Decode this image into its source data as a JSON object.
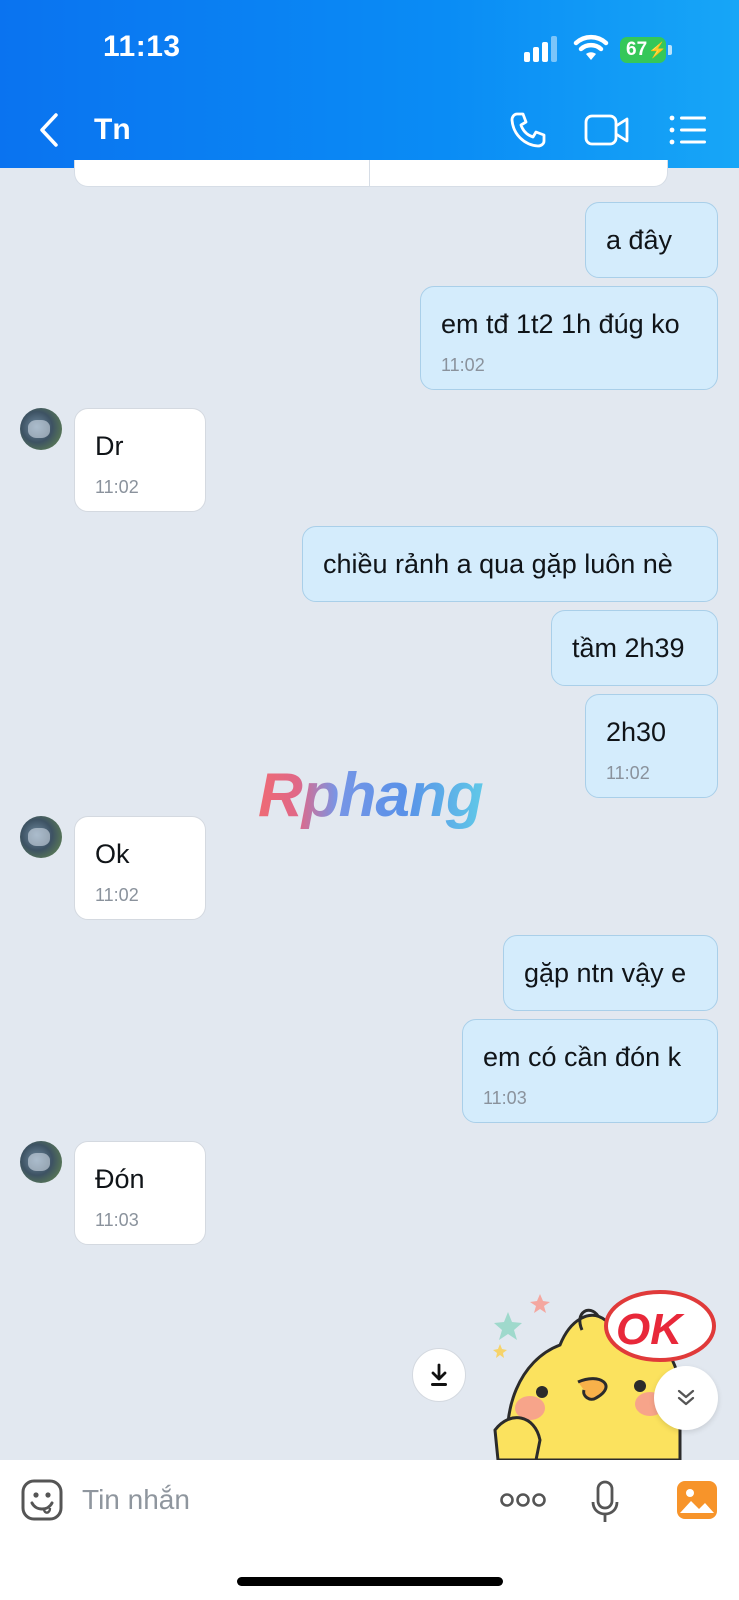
{
  "status_bar": {
    "time": "11:13",
    "battery": "67"
  },
  "header": {
    "title": "Tn",
    "icons": [
      "back-icon",
      "phone-icon",
      "video-call-icon",
      "menu-list-icon"
    ]
  },
  "messages": [
    {
      "dir": "out",
      "text": "a đây",
      "time": ""
    },
    {
      "dir": "out",
      "text": "em tđ 1t2 1h đúg ko",
      "time": "11:02"
    },
    {
      "dir": "in",
      "text": "Dr",
      "time": "11:02"
    },
    {
      "dir": "out",
      "text": "chiều rảnh a qua gặp luôn nè",
      "time": ""
    },
    {
      "dir": "out",
      "text": "tầm 2h39",
      "time": ""
    },
    {
      "dir": "out",
      "text": "2h30",
      "time": "11:02"
    },
    {
      "dir": "in",
      "text": "Ok",
      "time": "11:02"
    },
    {
      "dir": "out",
      "text": "gặp ntn vậy e",
      "time": ""
    },
    {
      "dir": "out",
      "text": "em có cần đón k",
      "time": "11:03"
    },
    {
      "dir": "in",
      "text": "Đón",
      "time": "11:03"
    }
  ],
  "watermark": "Rphang",
  "sticker": {
    "text": "OK"
  },
  "input": {
    "placeholder": "Tin nhắn"
  },
  "colors": {
    "header": "#0a80f2",
    "out_bubble": "#d4ecfc",
    "in_bubble": "#ffffff",
    "chat_bg": "#e2e8f0",
    "image_icon": "#f7942a"
  }
}
